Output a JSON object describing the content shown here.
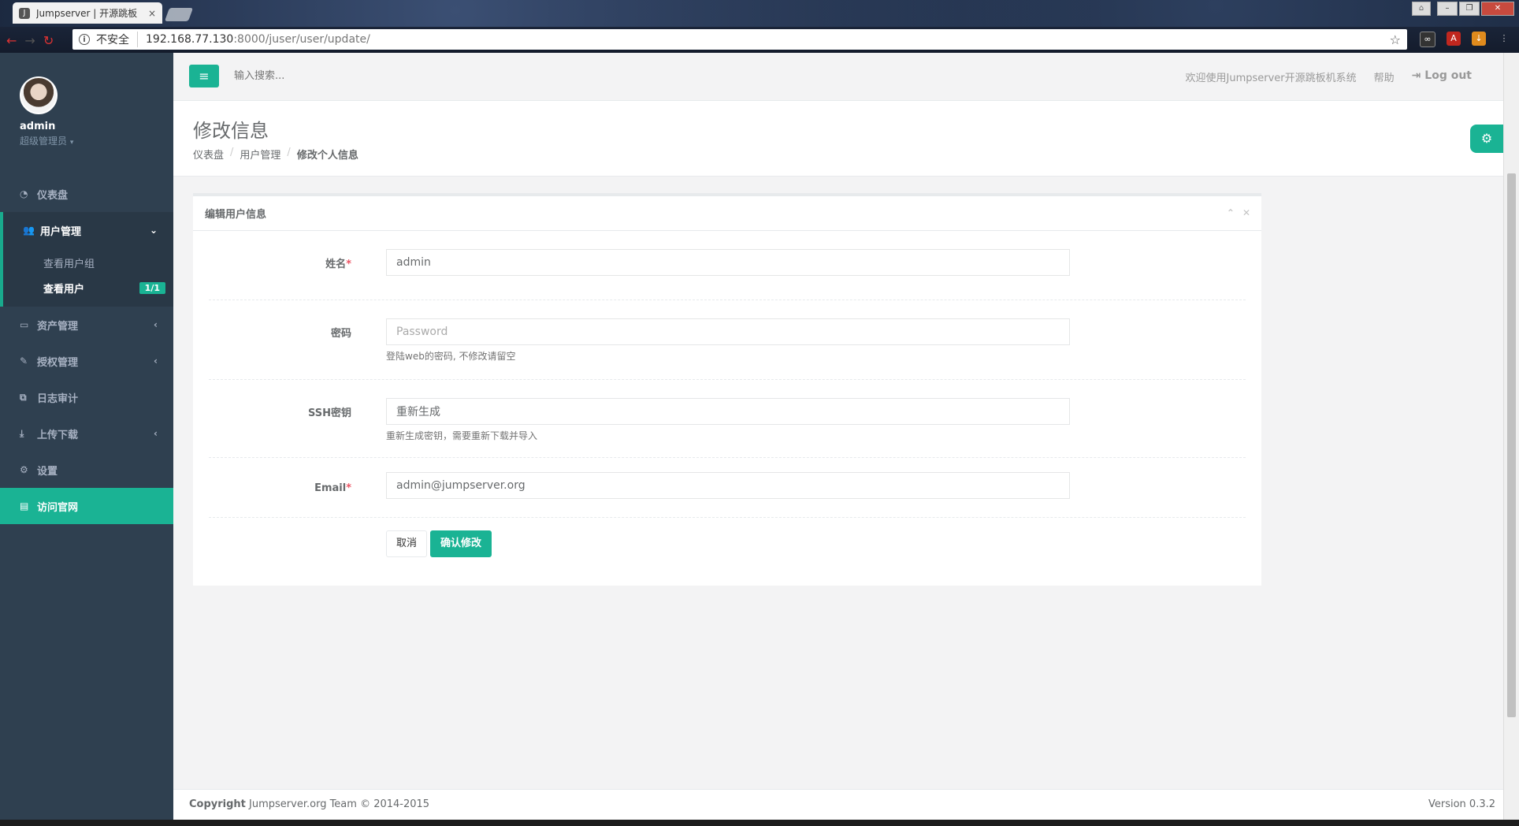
{
  "browser": {
    "tab_title": "Jumpserver | 开源跳板",
    "tab_close": "×",
    "security_label": "不安全",
    "url_host": "192.168.77.130",
    "url_rest": ":8000/juser/user/update/"
  },
  "sidebar": {
    "username": "admin",
    "role": "超级管理员",
    "items": [
      {
        "label": "仪表盘",
        "icon": "dashboard-icon"
      },
      {
        "label": "用户管理",
        "icon": "users-icon"
      },
      {
        "label": "资产管理",
        "icon": "hdd-icon"
      },
      {
        "label": "授权管理",
        "icon": "edit-icon"
      },
      {
        "label": "日志审计",
        "icon": "files-icon"
      },
      {
        "label": "上传下载",
        "icon": "download-icon"
      },
      {
        "label": "设置",
        "icon": "cogs-icon"
      },
      {
        "label": "访问官网",
        "icon": "book-icon"
      }
    ],
    "user_sub": [
      {
        "label": "查看用户组"
      },
      {
        "label": "查看用户",
        "badge": "1/1"
      }
    ]
  },
  "topbar": {
    "search_placeholder": "输入搜索...",
    "welcome": "欢迎使用Jumpserver开源跳板机系统",
    "help": "帮助",
    "logout": "Log out"
  },
  "heading": {
    "title": "修改信息",
    "breadcrumb": [
      "仪表盘",
      "用户管理",
      "修改个人信息"
    ]
  },
  "panel": {
    "title": "编辑用户信息",
    "fields": {
      "name": {
        "label": "姓名",
        "value": "admin"
      },
      "password": {
        "label": "密码",
        "placeholder": "Password",
        "help": "登陆web的密码, 不修改请留空"
      },
      "ssh": {
        "label": "SSH密钥",
        "value": "重新生成",
        "help": "重新生成密钥，需要重新下载并导入"
      },
      "email": {
        "label": "Email",
        "value": "admin@jumpserver.org"
      }
    },
    "cancel": "取消",
    "submit": "确认修改"
  },
  "footer": {
    "copyright_bold": "Copyright",
    "copyright": " Jumpserver.org Team © 2014-2015",
    "version": "Version 0.3.2"
  },
  "colors": {
    "accent": "#1ab394",
    "sidebar": "#2f4050"
  }
}
